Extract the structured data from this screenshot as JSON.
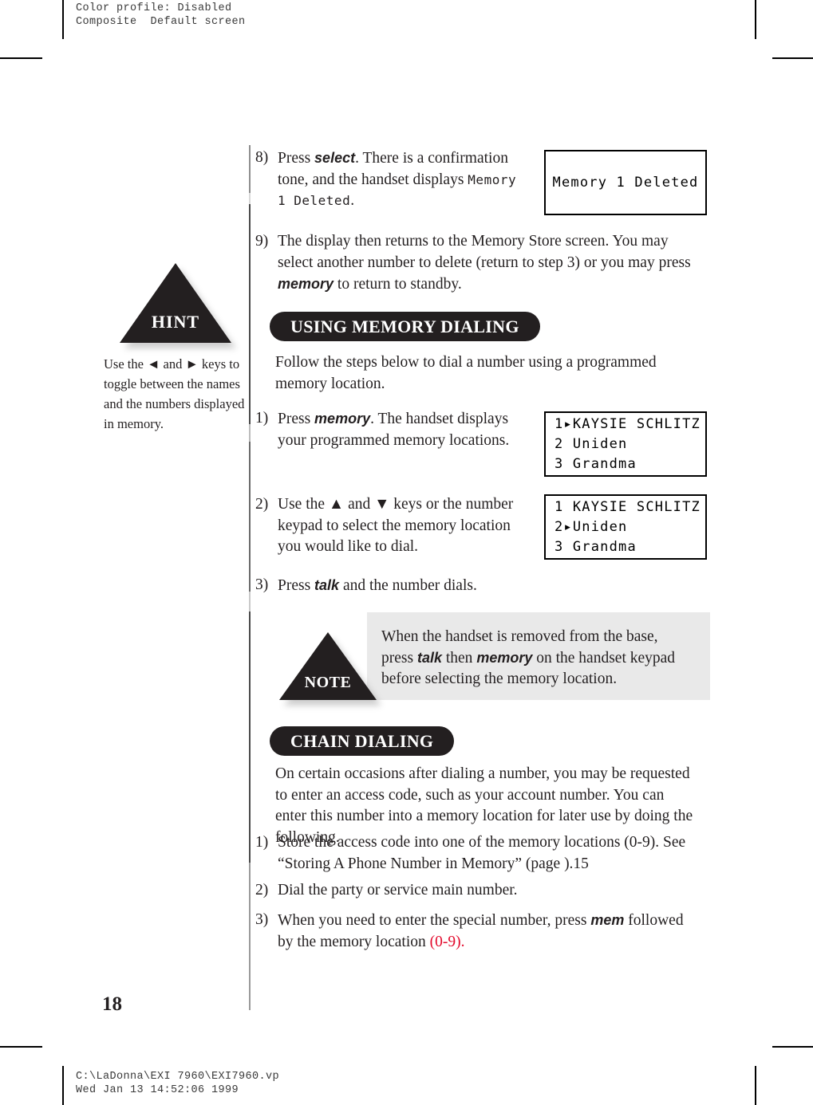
{
  "proof": {
    "header": "Color profile: Disabled\nComposite  Default screen",
    "footer": "C:\\LaDonna\\EXI 7960\\EXI7960.vp\nWed Jan 13 14:52:06 1999"
  },
  "page": {
    "number": "18"
  },
  "colors": {
    "ink": "#231f20",
    "edit_red": "#e3092b",
    "note_panel": "#e9e9e9"
  },
  "hint_callout": {
    "label": "HINT",
    "text_line1": "Use the ◄ and ► keys to",
    "text_line2": "toggle between the names",
    "text_line3": "and the numbers displayed",
    "text_line4": "in memory."
  },
  "note_callout": {
    "label": "NOTE",
    "line1_a": "When the handset is removed from the base,",
    "line2_a": "press ",
    "line2_kw1": "talk",
    "line2_b": " then ",
    "line2_kw2": "memory",
    "line2_c": " on the handset keypad",
    "line3_a": "before selecting the memory location."
  },
  "steps_continued": {
    "step8": {
      "num": "8)",
      "a": "Press ",
      "kw1": "select",
      "b": ". There is a confirmation tone, and the handset displays ",
      "lcd_inline": "Memory 1 Deleted",
      "c": "."
    },
    "step9": {
      "num": "9)",
      "a": "The display then returns to the Memory Store screen. You may select another number to delete (return to step 3) or you may press ",
      "kw1": "memory",
      "b": " to return to standby."
    }
  },
  "display_deleted": {
    "text": "Memory 1 Deleted"
  },
  "section_memory_dialing": {
    "heading": "USING MEMORY DIALING",
    "intro": "Follow the steps below to dial a number using a programmed memory location.",
    "steps": [
      {
        "num": "1)",
        "a": "Press ",
        "kw1": "memory",
        "b": ". The handset displays your programmed memory locations."
      },
      {
        "num": "2)",
        "a": "Use the ▲ and ▼ keys or the number  keypad to select the memory location you would like to dial.",
        "kw1": "",
        "b": ""
      },
      {
        "num": "3)",
        "a": "Press ",
        "kw1": "talk",
        "b": " and the number dials."
      }
    ]
  },
  "display_memory_list_1": {
    "line1": "1▸KAYSIE SCHLITZ",
    "line2": "2 Uniden",
    "line3": "3 Grandma"
  },
  "display_memory_list_2": {
    "line1": "1 KAYSIE SCHLITZ",
    "line2": "2▸Uniden",
    "line3": "3 Grandma"
  },
  "section_chain_dialing": {
    "heading": "CHAIN DIALING",
    "intro": "On certain occasions after dialing a number, you may be requested to enter an access code, such as your account number. You can enter this number into a memory location for later use by doing the following.",
    "steps": [
      {
        "num": "1)",
        "a": "Store the access code into one of the memory locations (0-9). See “Storing A Phone Number in Memory” (page ).15",
        "kw1": "",
        "b": ""
      },
      {
        "num": "2)",
        "a": "Dial the party or service main number.",
        "kw1": "",
        "b": ""
      },
      {
        "num": "3)",
        "a": "When you need to enter the special number, press ",
        "kw1": "mem",
        "b": "  followed by the memory location ",
        "red": "(0-9)."
      }
    ]
  }
}
